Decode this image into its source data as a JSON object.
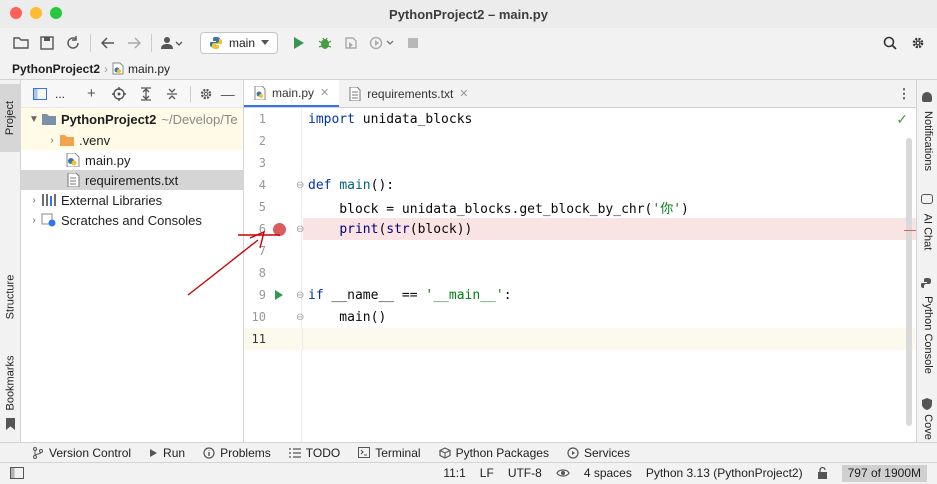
{
  "window": {
    "title": "PythonProject2 – main.py"
  },
  "toolbar": {
    "run_config": "main"
  },
  "breadcrumb": {
    "project": "PythonProject2",
    "file": "main.py"
  },
  "left_strip": {
    "project": "Project",
    "structure": "Structure",
    "bookmarks": "Bookmarks"
  },
  "project_panel": {
    "header_label": "...",
    "tree": [
      {
        "label": "PythonProject2",
        "path": "~/Develop/Te",
        "type": "folder",
        "expanded": true
      },
      {
        "label": ".venv",
        "type": "folder"
      },
      {
        "label": "main.py",
        "type": "python-file"
      },
      {
        "label": "requirements.txt",
        "type": "text-file",
        "selected": true
      },
      {
        "label": "External Libraries",
        "type": "library"
      },
      {
        "label": "Scratches and Consoles",
        "type": "scratch"
      }
    ]
  },
  "editor": {
    "tabs": [
      {
        "label": "main.py",
        "active": true
      },
      {
        "label": "requirements.txt",
        "active": false
      }
    ],
    "lines": [
      {
        "num": "1"
      },
      {
        "num": "2"
      },
      {
        "num": "3"
      },
      {
        "num": "4"
      },
      {
        "num": "5"
      },
      {
        "num": "6",
        "breakpoint": true
      },
      {
        "num": "7"
      },
      {
        "num": "8"
      },
      {
        "num": "9",
        "run_marker": true
      },
      {
        "num": "10"
      },
      {
        "num": "11"
      }
    ],
    "code": {
      "l1_kw": "import",
      "l1_rest": " unidata_blocks",
      "l4_kw": "def",
      "l4_fn": "main",
      "l4_rest": "():",
      "l5_a": "    block = unidata_blocks.get_block_by_chr(",
      "l5_str": "'你'",
      "l5_b": ")",
      "l6_indent": "    ",
      "l6_print": "print",
      "l6_a": "(",
      "l6_str": "str",
      "l6_b": "(block))",
      "l9_kw": "if",
      "l9_rest": " __name__ == ",
      "l9_str": "'__main__'",
      "l9_end": ":",
      "l10": "    main()"
    }
  },
  "right_strip": {
    "notifications": "Notifications",
    "ai_chat": "AI Chat",
    "python_console": "Python Console",
    "coverage": "Cove"
  },
  "bottom_tabs": [
    "Version Control",
    "Run",
    "Problems",
    "TODO",
    "Terminal",
    "Python Packages",
    "Services"
  ],
  "status": {
    "position": "11:1",
    "line_sep": "LF",
    "encoding": "UTF-8",
    "indent": "4 spaces",
    "interpreter": "Python 3.13 (PythonProject2)",
    "memory": "797 of 1900M"
  },
  "colors": {
    "accent": "#3574f0",
    "breakpoint": "#db5c5c",
    "breakpoint_line": "#fae3e3",
    "annotation": "#cc0000"
  }
}
